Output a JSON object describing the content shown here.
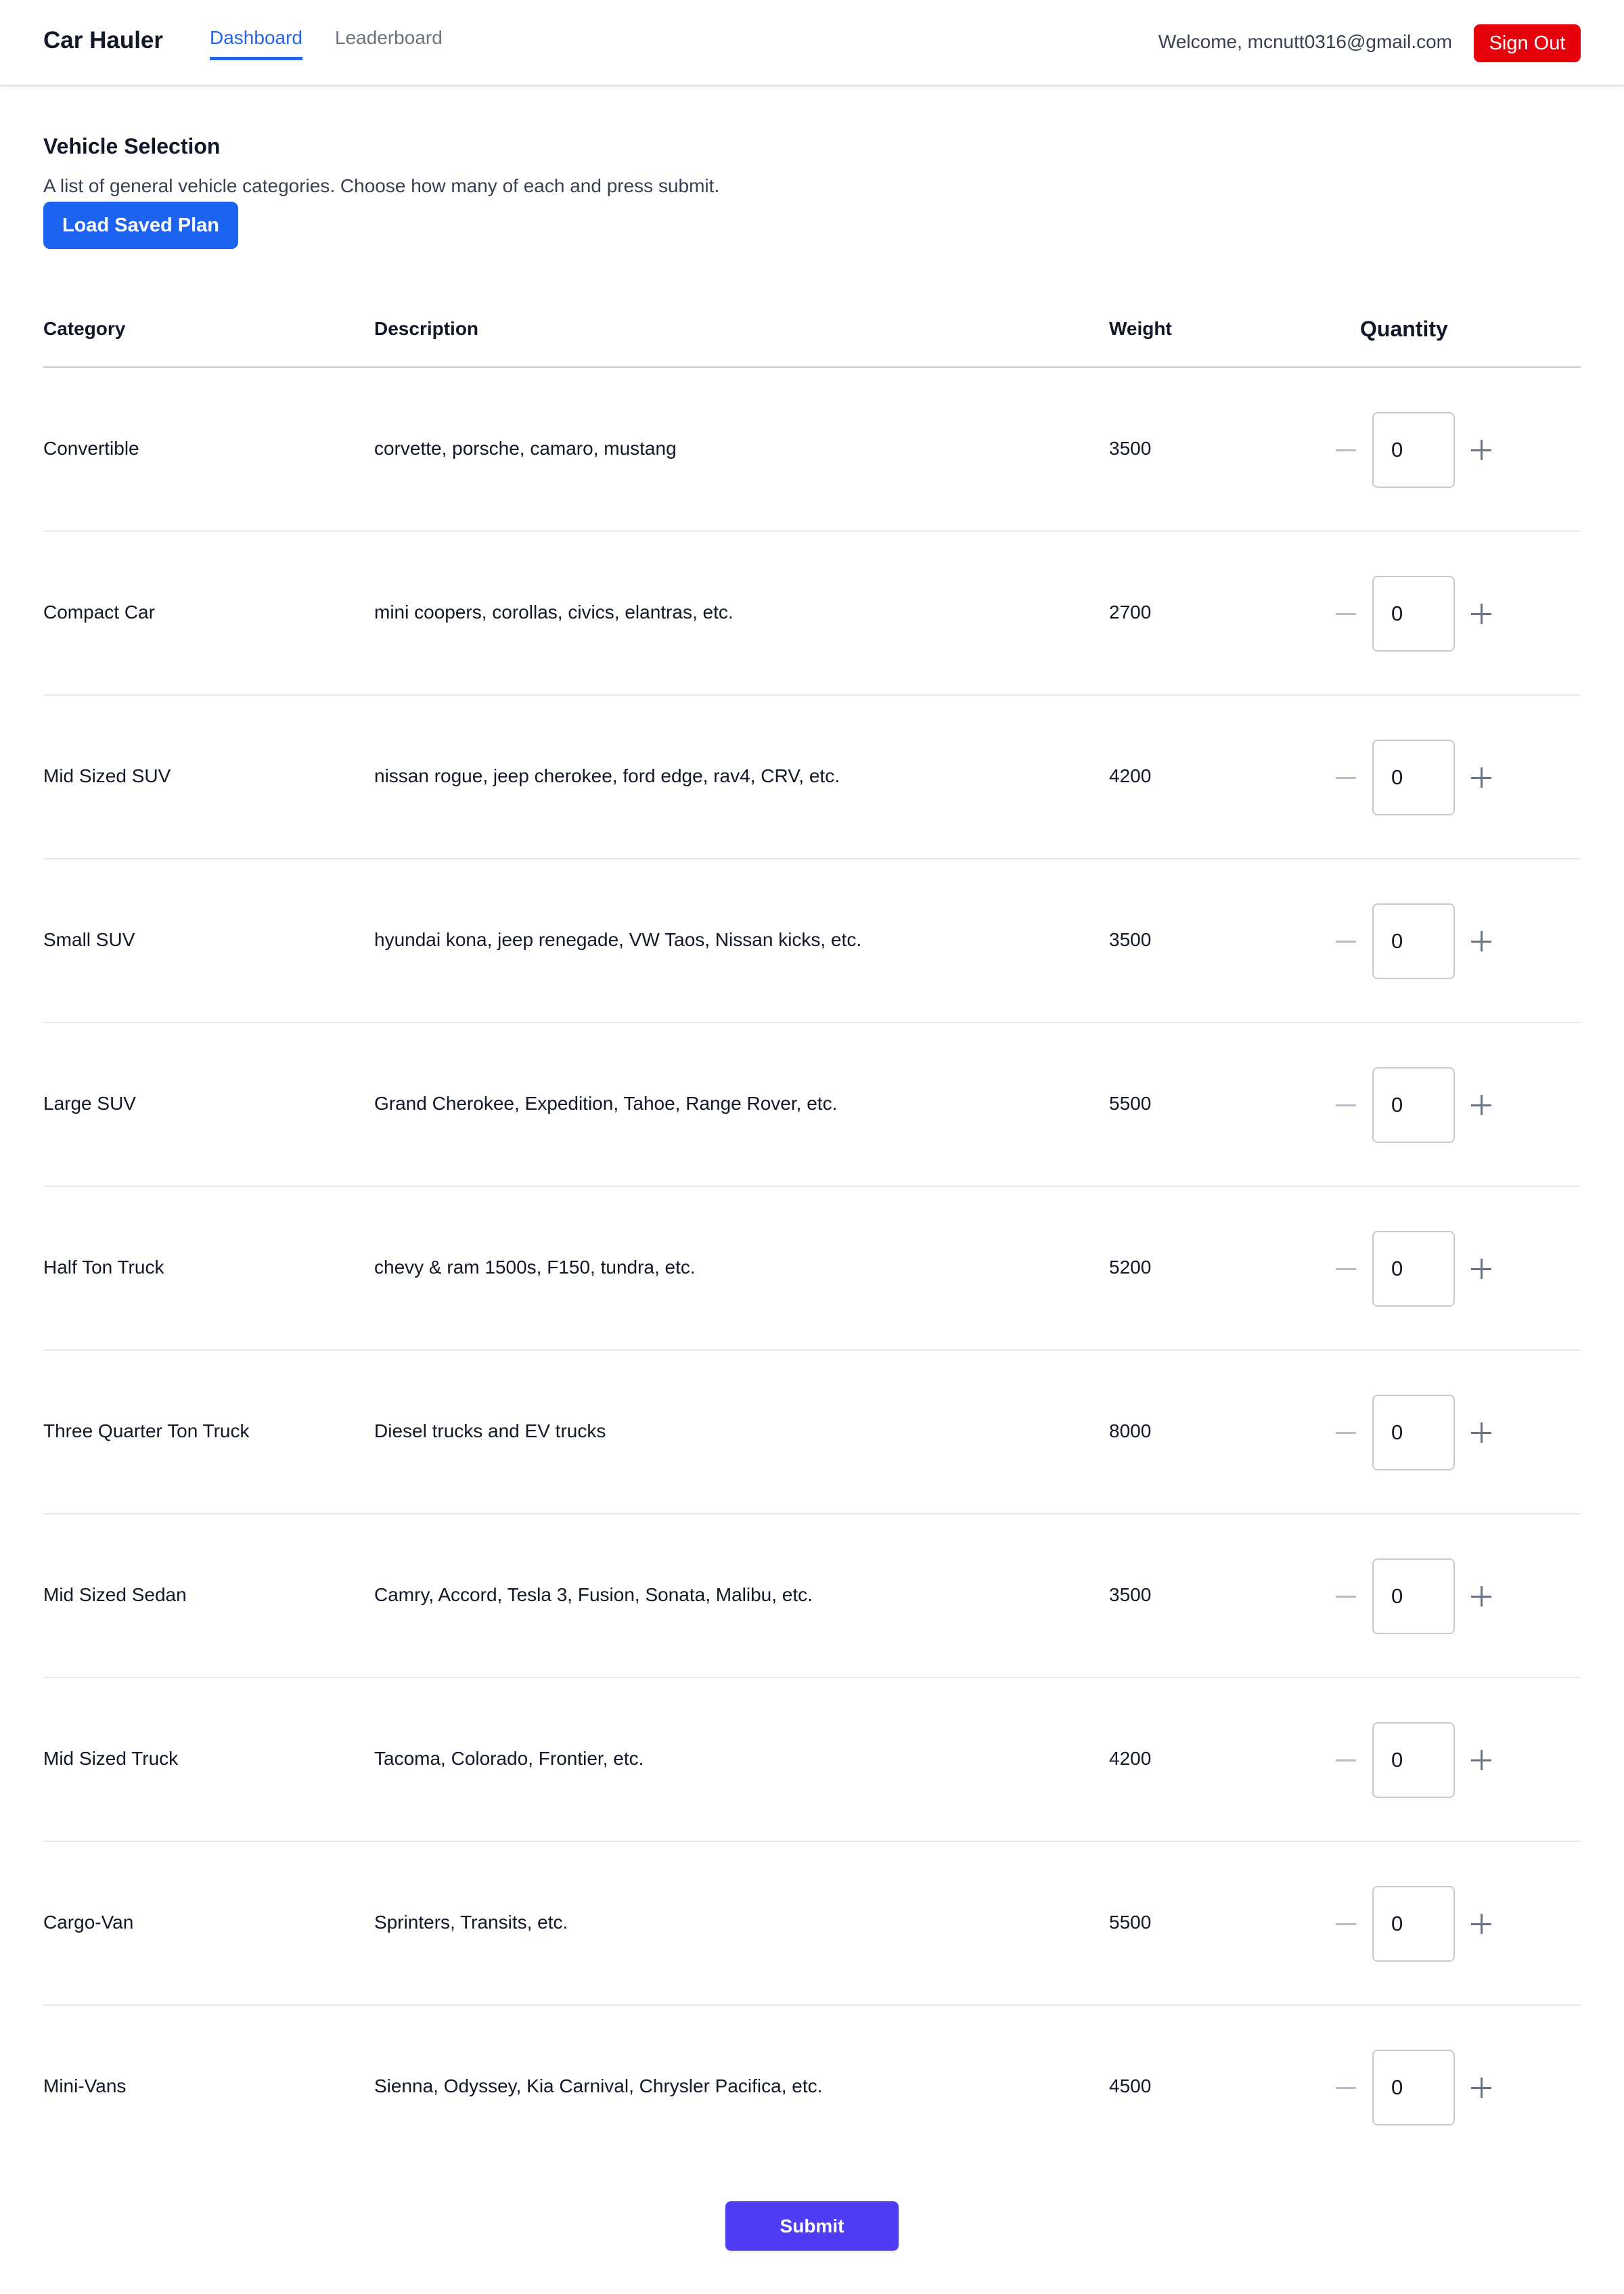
{
  "header": {
    "brand": "Car Hauler",
    "tabs": [
      {
        "label": "Dashboard",
        "active": true
      },
      {
        "label": "Leaderboard",
        "active": false
      }
    ],
    "welcome": "Welcome, mcnutt0316@gmail.com",
    "sign_out_label": "Sign Out"
  },
  "section": {
    "title": "Vehicle Selection",
    "description": "A list of general vehicle categories. Choose how many of each and press submit.",
    "load_button_label": "Load Saved Plan"
  },
  "table": {
    "headers": {
      "category": "Category",
      "description": "Description",
      "weight": "Weight",
      "quantity": "Quantity"
    },
    "rows": [
      {
        "category": "Convertible",
        "description": "corvette, porsche, camaro, mustang",
        "weight": "3500",
        "quantity": "0"
      },
      {
        "category": "Compact Car",
        "description": "mini coopers, corollas, civics, elantras, etc.",
        "weight": "2700",
        "quantity": "0"
      },
      {
        "category": "Mid Sized SUV",
        "description": "nissan rogue, jeep cherokee, ford edge, rav4, CRV, etc.",
        "weight": "4200",
        "quantity": "0"
      },
      {
        "category": "Small SUV",
        "description": "hyundai kona, jeep renegade, VW Taos, Nissan kicks, etc.",
        "weight": "3500",
        "quantity": "0"
      },
      {
        "category": "Large SUV",
        "description": "Grand Cherokee, Expedition, Tahoe, Range Rover, etc.",
        "weight": "5500",
        "quantity": "0"
      },
      {
        "category": "Half Ton Truck",
        "description": "chevy & ram 1500s, F150, tundra, etc.",
        "weight": "5200",
        "quantity": "0"
      },
      {
        "category": "Three Quarter Ton Truck",
        "description": "Diesel trucks and EV trucks",
        "weight": "8000",
        "quantity": "0"
      },
      {
        "category": "Mid Sized Sedan",
        "description": "Camry, Accord, Tesla 3, Fusion, Sonata, Malibu, etc.",
        "weight": "3500",
        "quantity": "0"
      },
      {
        "category": "Mid Sized Truck",
        "description": "Tacoma, Colorado, Frontier, etc.",
        "weight": "4200",
        "quantity": "0"
      },
      {
        "category": "Cargo-Van",
        "description": "Sprinters, Transits, etc.",
        "weight": "5500",
        "quantity": "0"
      },
      {
        "category": "Mini-Vans",
        "description": "Sienna, Odyssey, Kia Carnival, Chrysler Pacifica, etc.",
        "weight": "4500",
        "quantity": "0"
      }
    ]
  },
  "submit_label": "Submit",
  "icons": {
    "decrement": "minus-icon",
    "increment": "plus-icon"
  },
  "colors": {
    "accent": "#2563eb",
    "load_button": "#1d63f2",
    "sign_out": "#e5000c",
    "submit": "#4f3cf6"
  }
}
